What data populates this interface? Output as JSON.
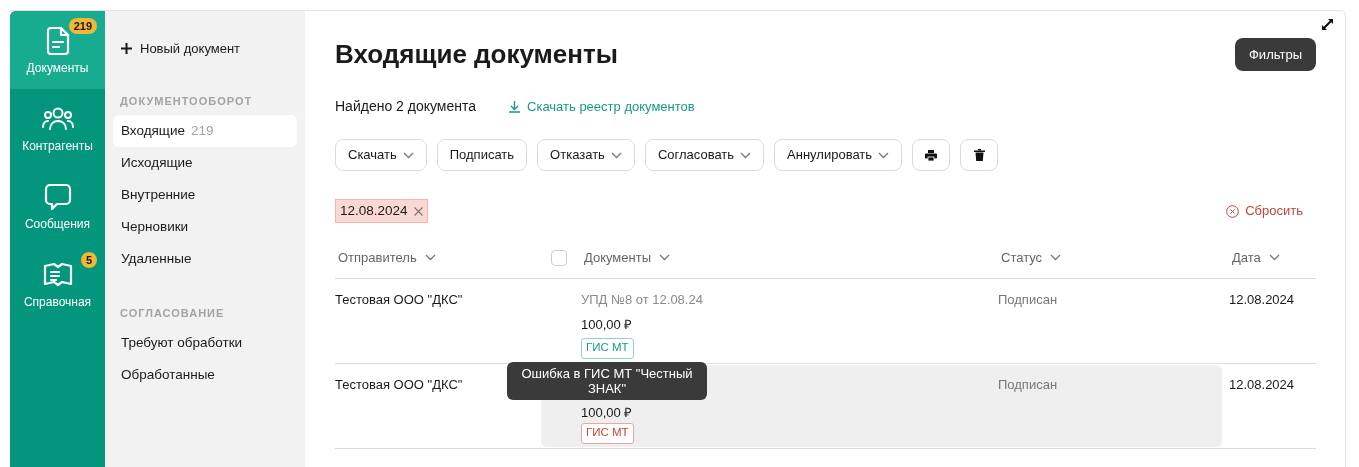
{
  "nav_rail": [
    {
      "label": "Документы",
      "badge": "219",
      "selected": true
    },
    {
      "label": "Контрагенты",
      "selected": false
    },
    {
      "label": "Сообщения",
      "selected": false
    },
    {
      "label": "Справочная",
      "badge": "5",
      "selected": false
    }
  ],
  "sidebar": {
    "new_document": "Новый документ",
    "sections": [
      {
        "title": "ДОКУМЕНТООБОРОТ",
        "items": [
          {
            "label": "Входящие",
            "count": "219",
            "selected": true
          },
          {
            "label": "Исходящие",
            "selected": false
          },
          {
            "label": "Внутренние",
            "selected": false
          },
          {
            "label": "Черновики",
            "selected": false
          },
          {
            "label": "Удаленные",
            "selected": false
          }
        ]
      },
      {
        "title": "СОГЛАСОВАНИЕ",
        "items": [
          {
            "label": "Требуют обработки",
            "selected": false
          },
          {
            "label": "Обработанные",
            "selected": false
          }
        ]
      }
    ]
  },
  "main": {
    "title": "Входящие документы",
    "filters_button": "Фильтры",
    "found": "Найдено 2 документа",
    "download_link": "Скачать реестр документов",
    "actions": [
      {
        "kind": "dropdown",
        "label": "Скачать"
      },
      {
        "kind": "plain",
        "label": "Подписать"
      },
      {
        "kind": "dropdown",
        "label": "Отказать"
      },
      {
        "kind": "dropdown",
        "label": "Согласовать"
      },
      {
        "kind": "dropdown",
        "label": "Аннулировать"
      },
      {
        "kind": "print"
      },
      {
        "kind": "trash"
      }
    ],
    "filter_chips": [
      {
        "label": "12.08.2024"
      }
    ],
    "reset": "Сбросить",
    "table": {
      "columns": [
        {
          "label": "Отправитель"
        },
        {
          "label": "Документы",
          "checkbox": {
            "checked": false
          }
        },
        {
          "label": "Статус"
        },
        {
          "label": "Дата"
        }
      ],
      "rows": [
        {
          "sender": "Тестовая ООО \"ДКС\"",
          "document": "УПД №8 от 12.08.24",
          "amount": "100,00 ₽",
          "tag": {
            "label": "ГИС МТ",
            "kind": "ok"
          },
          "status": "Подписан",
          "date": "12.08.2024",
          "hovered": false
        },
        {
          "sender": "Тестовая ООО \"ДКС\"",
          "amount": "100,00 ₽",
          "tag": {
            "label": "ГИС МТ",
            "kind": "error"
          },
          "status": "Подписан",
          "date": "12.08.2024",
          "hovered": true,
          "tooltip": "Ошибка в ГИС МТ \"Честный ЗНАК\""
        }
      ]
    }
  }
}
